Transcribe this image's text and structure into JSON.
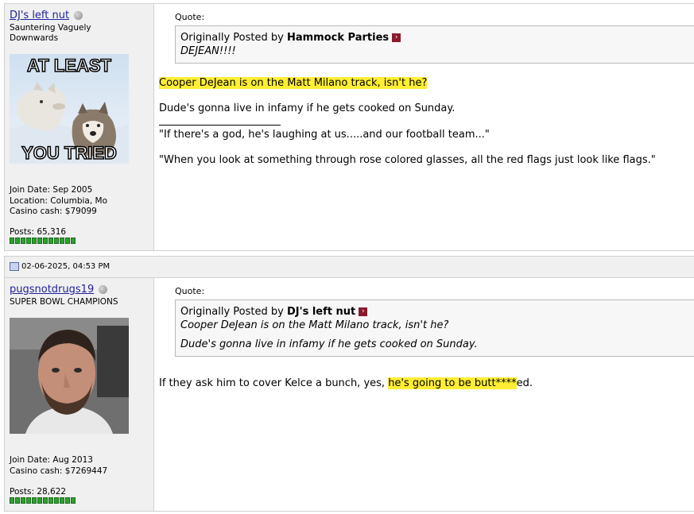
{
  "post1": {
    "username": "DJ's left nut",
    "user_title": "Sauntering Vaguely Downwards",
    "avatar": {
      "top_text": "AT LEAST",
      "bottom_text": "YOU TRIED"
    },
    "join_date": "Join Date: Sep 2005",
    "location": "Location: Columbia, Mo",
    "casino_cash": "Casino cash: $79099",
    "posts": "Posts: 65,316",
    "quote": {
      "label": "Quote:",
      "by_prefix": "Originally Posted by",
      "author": "Hammock Parties",
      "text": "DEJEAN!!!!"
    },
    "line1": "Cooper DeJean is on the Matt Milano track, isn't he?",
    "line2": "Dude's gonna live in infamy if he gets cooked on Sunday.",
    "sig1": "\"If there's a god, he's laughing at us.....and our football team...\"",
    "sig2": "\"When you look at something through rose colored glasses, all the red flags just look like flags.\""
  },
  "post2": {
    "date": "02-06-2025, 04:53 PM",
    "username": "pugsnotdrugs19",
    "user_title": "SUPER BOWL CHAMPIONS",
    "join_date": "Join Date: Aug 2013",
    "casino_cash": "Casino cash: $7269447",
    "posts": "Posts: 28,622",
    "quote": {
      "label": "Quote:",
      "by_prefix": "Originally Posted by",
      "author": "DJ's left nut",
      "text1": "Cooper DeJean is on the Matt Milano track, isn't he?",
      "text2": "Dude's gonna live in infamy if he gets cooked on Sunday."
    },
    "reply_pre": "If they ask him to cover Kelce a bunch, yes, ",
    "reply_hl": "he's going to be butt****",
    "reply_post": "ed."
  },
  "colors": {
    "username": "#22229c",
    "highlight": "#ffee33",
    "reputation": "#2ea02e",
    "pane_bg": "#f0f0f0"
  }
}
